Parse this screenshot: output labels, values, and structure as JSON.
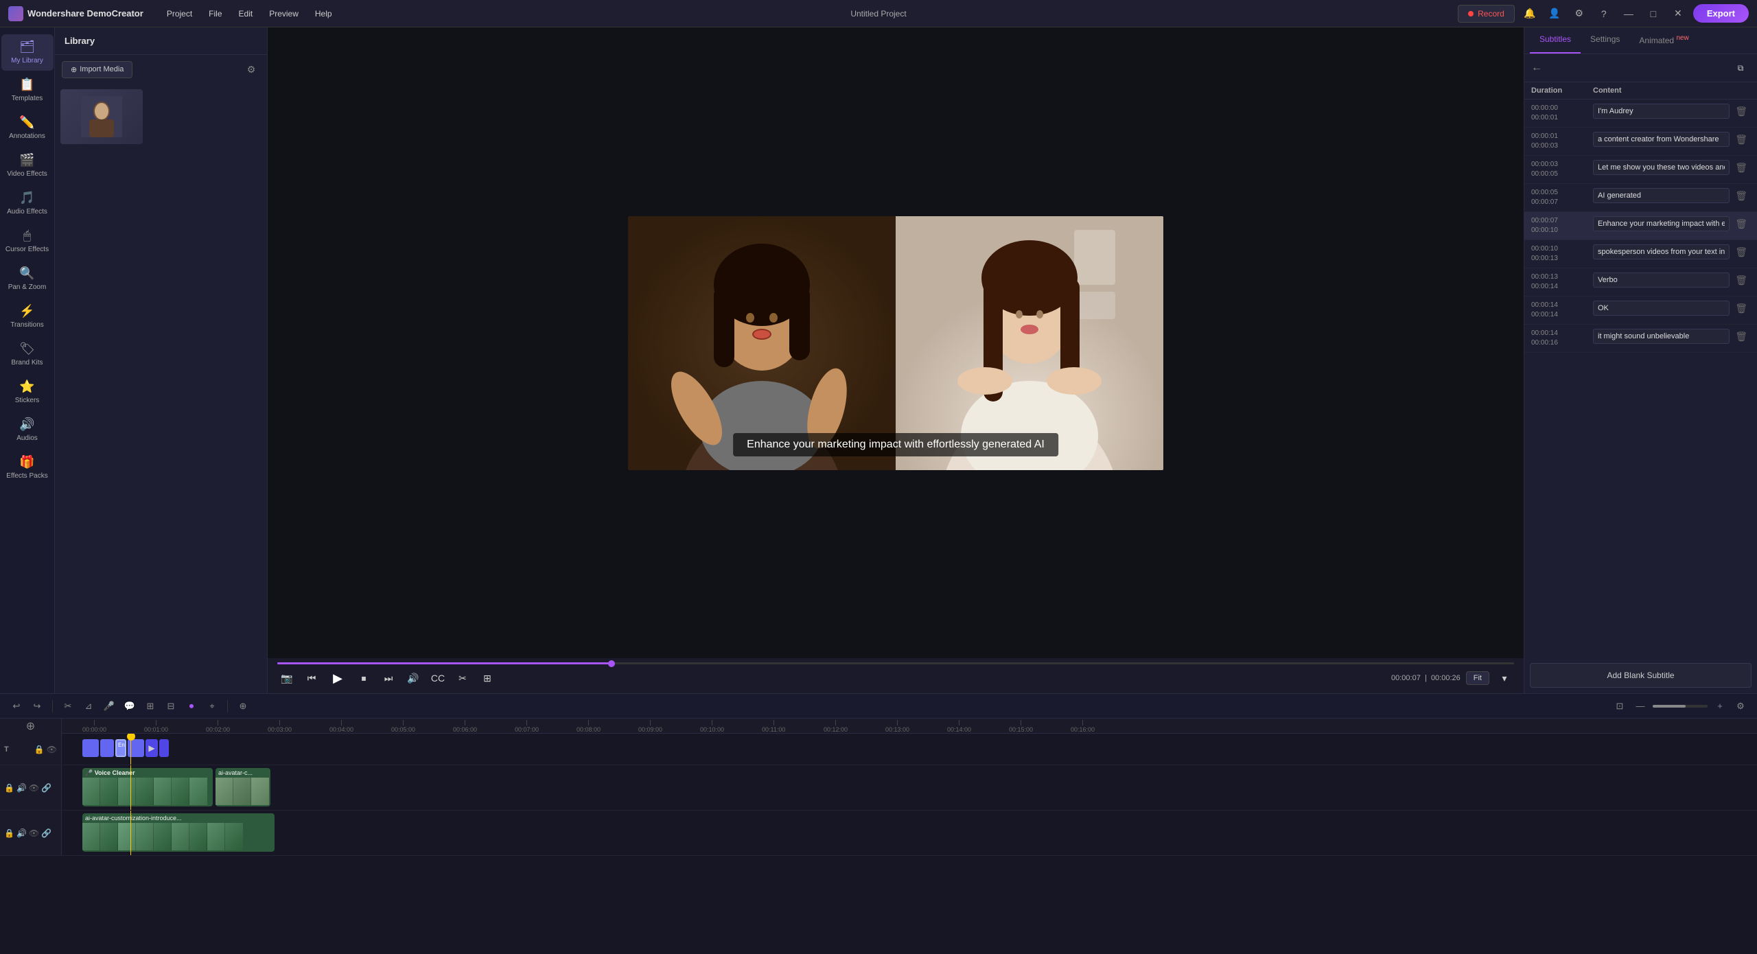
{
  "app": {
    "name": "Wondershare DemoCreator",
    "window_title": "Untitled Project"
  },
  "menu": {
    "items": [
      "Project",
      "File",
      "Edit",
      "Preview",
      "Help"
    ]
  },
  "toolbar": {
    "record_label": "Record",
    "export_label": "Export"
  },
  "sidebar": {
    "items": [
      {
        "id": "my-library",
        "label": "My Library",
        "icon": "🗂"
      },
      {
        "id": "templates",
        "label": "Templates",
        "icon": "📋"
      },
      {
        "id": "annotations",
        "label": "Annotations",
        "icon": "✏️"
      },
      {
        "id": "video-effects",
        "label": "Video Effects",
        "icon": "🎬"
      },
      {
        "id": "audio-effects",
        "label": "Audio Effects",
        "icon": "🎵"
      },
      {
        "id": "cursor-effects",
        "label": "Cursor Effects",
        "icon": "🖱"
      },
      {
        "id": "pan-zoom",
        "label": "Pan & Zoom",
        "icon": "🔍"
      },
      {
        "id": "transitions",
        "label": "Transitions",
        "icon": "⚡"
      },
      {
        "id": "brand-kits",
        "label": "Brand Kits",
        "icon": "🏷"
      },
      {
        "id": "stickers",
        "label": "Stickers",
        "icon": "⭐"
      },
      {
        "id": "audios",
        "label": "Audios",
        "icon": "🔊"
      },
      {
        "id": "effects-packs",
        "label": "Effects Packs",
        "icon": "🎁"
      }
    ]
  },
  "library": {
    "title": "Library",
    "import_label": "Import Media",
    "filter_icon": "filter"
  },
  "video": {
    "subtitle_overlay": "Enhance your marketing impact with effortlessly generated AI",
    "time_current": "00:00:07",
    "time_total": "00:00:26",
    "progress_percent": 27,
    "fit_label": "Fit"
  },
  "subtitles_panel": {
    "tabs": [
      {
        "id": "subtitles",
        "label": "Subtitles",
        "active": true
      },
      {
        "id": "settings",
        "label": "Settings",
        "active": false
      },
      {
        "id": "animated",
        "label": "Animated",
        "active": false,
        "badge": "new"
      }
    ],
    "add_blank_label": "Add Blank Subtitle",
    "columns": {
      "duration": "Duration",
      "content": "Content"
    },
    "rows": [
      {
        "id": 1,
        "start": "00:00:00",
        "end": "00:00:01",
        "text": "I'm Audrey"
      },
      {
        "id": 2,
        "start": "00:00:01",
        "end": "00:00:03",
        "text": "a content creator from Wondershare"
      },
      {
        "id": 3,
        "start": "00:00:03",
        "end": "00:00:05",
        "text": "Let me show you these two videos and you tell me which one is"
      },
      {
        "id": 4,
        "start": "00:00:05",
        "end": "00:00:07",
        "text": "AI generated"
      },
      {
        "id": 5,
        "start": "00:00:07",
        "end": "00:00:10",
        "text": "Enhance your marketing impact with effortlessly generated AI"
      },
      {
        "id": 6,
        "start": "00:00:10",
        "end": "00:00:13",
        "text": "spokesperson videos from your text inputs using Wondershare"
      },
      {
        "id": 7,
        "start": "00:00:13",
        "end": "00:00:14",
        "text": "Verbo"
      },
      {
        "id": 8,
        "start": "00:00:14",
        "end": "00:00:14",
        "text": "OK"
      },
      {
        "id": 9,
        "start": "00:00:14",
        "end": "00:00:16",
        "text": "it might sound unbelievable"
      }
    ]
  },
  "timeline": {
    "zoom_level": 60,
    "playhead_position": "00:00:07",
    "tracks": [
      {
        "id": "T",
        "label": "T",
        "type": "subtitle"
      },
      {
        "id": "V1",
        "label": "",
        "type": "video",
        "has_voice": true
      },
      {
        "id": "V2",
        "label": "",
        "type": "video",
        "has_voice": false
      }
    ],
    "ruler_marks": [
      "00:00:00",
      "00:01:00",
      "00:02:00",
      "00:03:00",
      "00:04:00",
      "00:05:00",
      "00:06:00",
      "00:07:00",
      "00:08:00",
      "00:09:00",
      "00:10:00",
      "00:11:00",
      "00:12:00",
      "00:13:00",
      "00:14:00",
      "00:15:00",
      "00:16:00"
    ]
  },
  "colors": {
    "accent": "#a855f7",
    "accent_dark": "#7c3aed",
    "record_red": "#ff4444",
    "playhead": "#ffcc00",
    "subtitle_clip": "#6366f1",
    "video_clip_green": "#3d8c4f"
  }
}
